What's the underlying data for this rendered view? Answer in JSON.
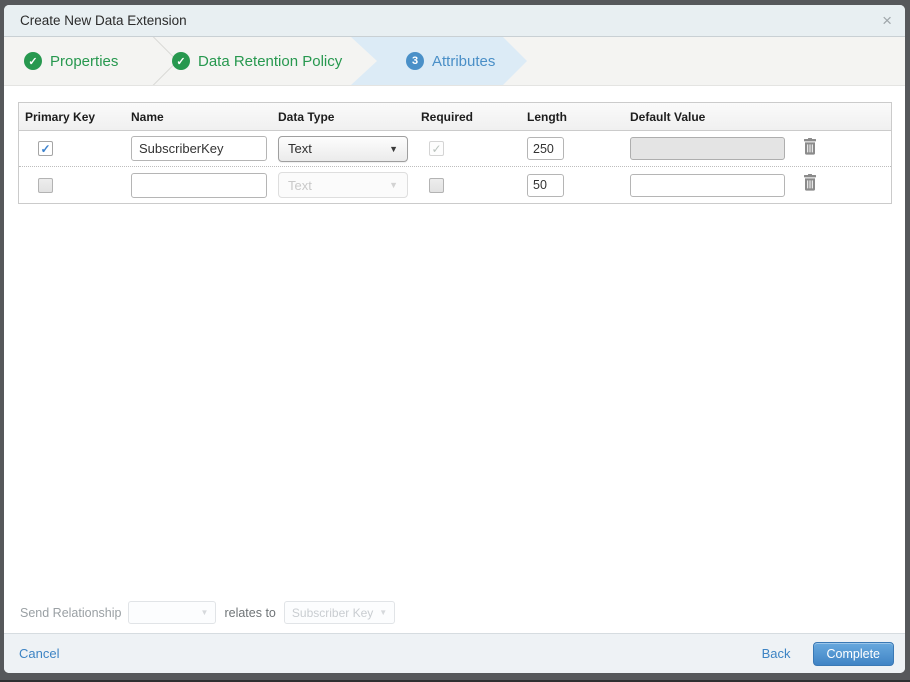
{
  "modal": {
    "title": "Create New Data Extension"
  },
  "icons": {
    "close": "×",
    "check": "✓",
    "caret": "▼"
  },
  "steps": [
    {
      "label": "Properties",
      "status": "complete"
    },
    {
      "label": "Data Retention Policy",
      "status": "complete"
    },
    {
      "label": "Attributes",
      "number": "3",
      "status": "active"
    }
  ],
  "table": {
    "headers": [
      "Primary Key",
      "Name",
      "Data Type",
      "Required",
      "Length",
      "Default Value"
    ],
    "rows": [
      {
        "primary_key": true,
        "name": "SubscriberKey",
        "data_type": "Text",
        "required": true,
        "length": "250",
        "default_value": "",
        "default_disabled": true
      },
      {
        "primary_key": false,
        "name": "",
        "data_type": "Text",
        "required": false,
        "length": "50",
        "default_value": "",
        "default_disabled": false
      }
    ]
  },
  "send_relationship": {
    "label": "Send Relationship",
    "relates_to_label": "relates to",
    "target_field": "Subscriber Key"
  },
  "footer": {
    "cancel_label": "Cancel",
    "back_label": "Back",
    "complete_label": "Complete"
  },
  "colors": {
    "step_complete_green": "#27984f",
    "step_active_blue": "#4a8fc7",
    "step_active_bg": "#dcebf6",
    "link_blue": "#3d84c4",
    "complete_button_blue": "#4084c5",
    "titlebar_bg": "#e8eff2",
    "frame_gray": "#56585b"
  }
}
